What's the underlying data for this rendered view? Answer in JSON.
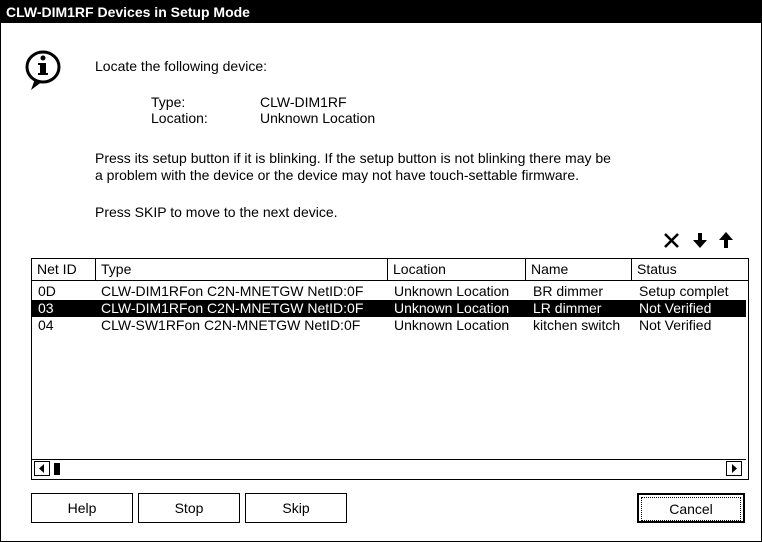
{
  "window": {
    "title": "CLW-DIM1RF Devices in Setup Mode"
  },
  "message": {
    "intro": "Locate the following device:",
    "type_label": "Type:",
    "type_value": "CLW-DIM1RF",
    "location_label": "Location:",
    "location_value": "Unknown Location",
    "instruction_line1": "Press its setup button if it is blinking.  If the setup button is not blinking there may be",
    "instruction_line2": "a problem with the device or the device may not have touch-settable firmware.",
    "skip_note": "Press SKIP to move to the next device."
  },
  "toolbar": {
    "delete_icon": "close-icon",
    "down_icon": "arrow-down-icon",
    "up_icon": "arrow-up-icon"
  },
  "table": {
    "columns": [
      "Net ID",
      "Type",
      "Location",
      "Name",
      "Status"
    ],
    "rows": [
      {
        "netid": "0D",
        "type": "CLW-DIM1RFon C2N-MNETGW NetID:0F",
        "location": "Unknown Location",
        "name": "BR dimmer",
        "status": "Setup complet",
        "selected": false
      },
      {
        "netid": "03",
        "type": "CLW-DIM1RFon C2N-MNETGW NetID:0F",
        "location": "Unknown Location",
        "name": "LR dimmer",
        "status": "Not Verified",
        "selected": true
      },
      {
        "netid": "04",
        "type": "CLW-SW1RFon C2N-MNETGW NetID:0F",
        "location": "Unknown Location",
        "name": "kitchen switch",
        "status": "Not Verified",
        "selected": false
      }
    ]
  },
  "buttons": {
    "help": "Help",
    "stop": "Stop",
    "skip": "Skip",
    "cancel": "Cancel"
  }
}
